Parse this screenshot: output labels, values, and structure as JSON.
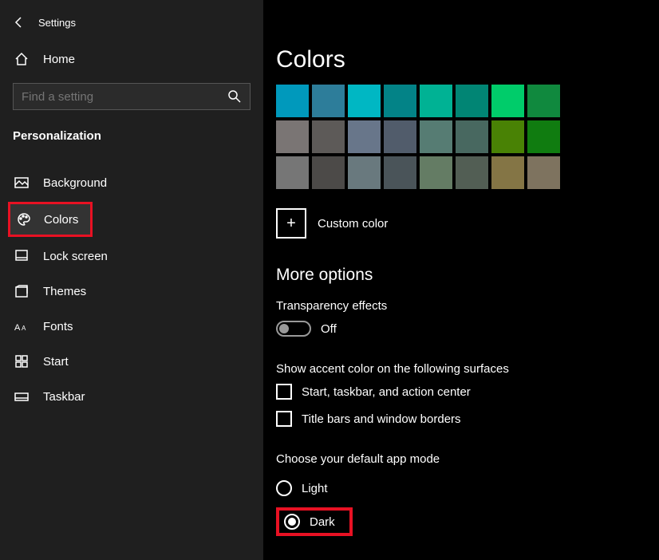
{
  "app": {
    "title": "Settings"
  },
  "home_label": "Home",
  "search": {
    "placeholder": "Find a setting"
  },
  "section_title": "Personalization",
  "nav": {
    "background": "Background",
    "colors": "Colors",
    "lock_screen": "Lock screen",
    "themes": "Themes",
    "fonts": "Fonts",
    "start": "Start",
    "taskbar": "Taskbar"
  },
  "page": {
    "title": "Colors",
    "swatches": [
      [
        "#0099bc",
        "#2d7d9a",
        "#00b7c3",
        "#038387",
        "#00b294",
        "#018574",
        "#00cc6a",
        "#10893e"
      ],
      [
        "#7a7574",
        "#5d5a58",
        "#68768a",
        "#515c6b",
        "#567c73",
        "#486860",
        "#498205",
        "#107c10"
      ],
      [
        "#767676",
        "#4c4a48",
        "#69797e",
        "#4a5459",
        "#647c64",
        "#525e54",
        "#847545",
        "#7e735f"
      ]
    ],
    "custom_label": "Custom color",
    "more_options": "More options",
    "transparency_label": "Transparency effects",
    "transparency_value": "Off",
    "accent_surface_label": "Show accent color on the following surfaces",
    "accent_opts": {
      "taskbar": "Start, taskbar, and action center",
      "titlebars": "Title bars and window borders"
    },
    "app_mode_label": "Choose your default app mode",
    "app_mode": {
      "light": "Light",
      "dark": "Dark"
    }
  }
}
